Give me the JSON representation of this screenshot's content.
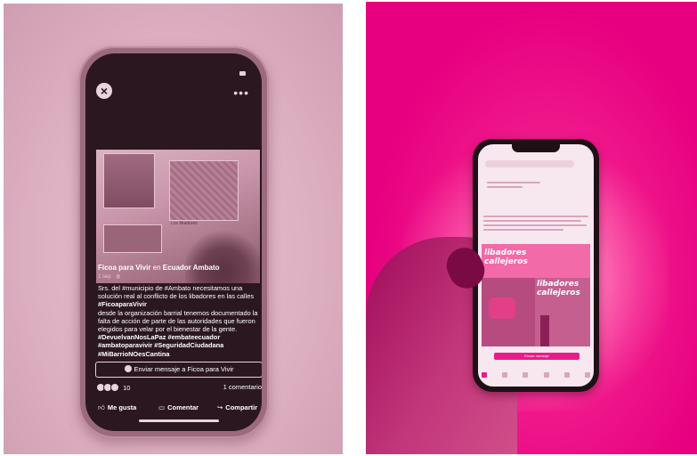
{
  "left_photo": {
    "post": {
      "author_page": "Ficoa para Vivir",
      "author_connector": " en ",
      "group": "Ecuador Ambato",
      "date": "1 sep · ",
      "text_lines": [
        "Srs. del #municipio de #Ambato necesitamos una",
        "solución real al conflicto de los libadores en las calles",
        "#FicoaparaVivir",
        "desde la organización barrial tenemos documentado la",
        "falta de acción de parte de las autoridades que fueron",
        "elegidos para velar por el bienestar de la gente."
      ],
      "hashtag_lines": [
        "#DevuelvanNosLaPaz #embateecuador",
        "#ambatoparavivir #SeguridadCiudadana",
        "#MiBarrioNOesCantina"
      ],
      "send_message_label": "Enviar mensaje a Ficoa para Vivir",
      "reaction_count": "10",
      "comments_count": "1 comentario",
      "like_label": "Me gusta",
      "comment_label": "Comentar",
      "share_label": "Compartir",
      "image_caption": "Los libadores"
    },
    "icons": {
      "close": "close-icon",
      "more": "more-options-icon",
      "like": "thumbs-up-icon",
      "comment": "comment-bubble-icon",
      "share": "share-arrow-icon",
      "messenger": "messenger-icon"
    }
  },
  "right_photo": {
    "screen": {
      "poster_title_top": "libadores\ncallejeros",
      "poster_title_bottom": "libadores\ncallejeros",
      "send_label": "Enviar mensaje"
    }
  },
  "colors": {
    "tint_left": "#deb1c2",
    "tint_right": "#e7007f",
    "accent": "#ec1a8b"
  }
}
